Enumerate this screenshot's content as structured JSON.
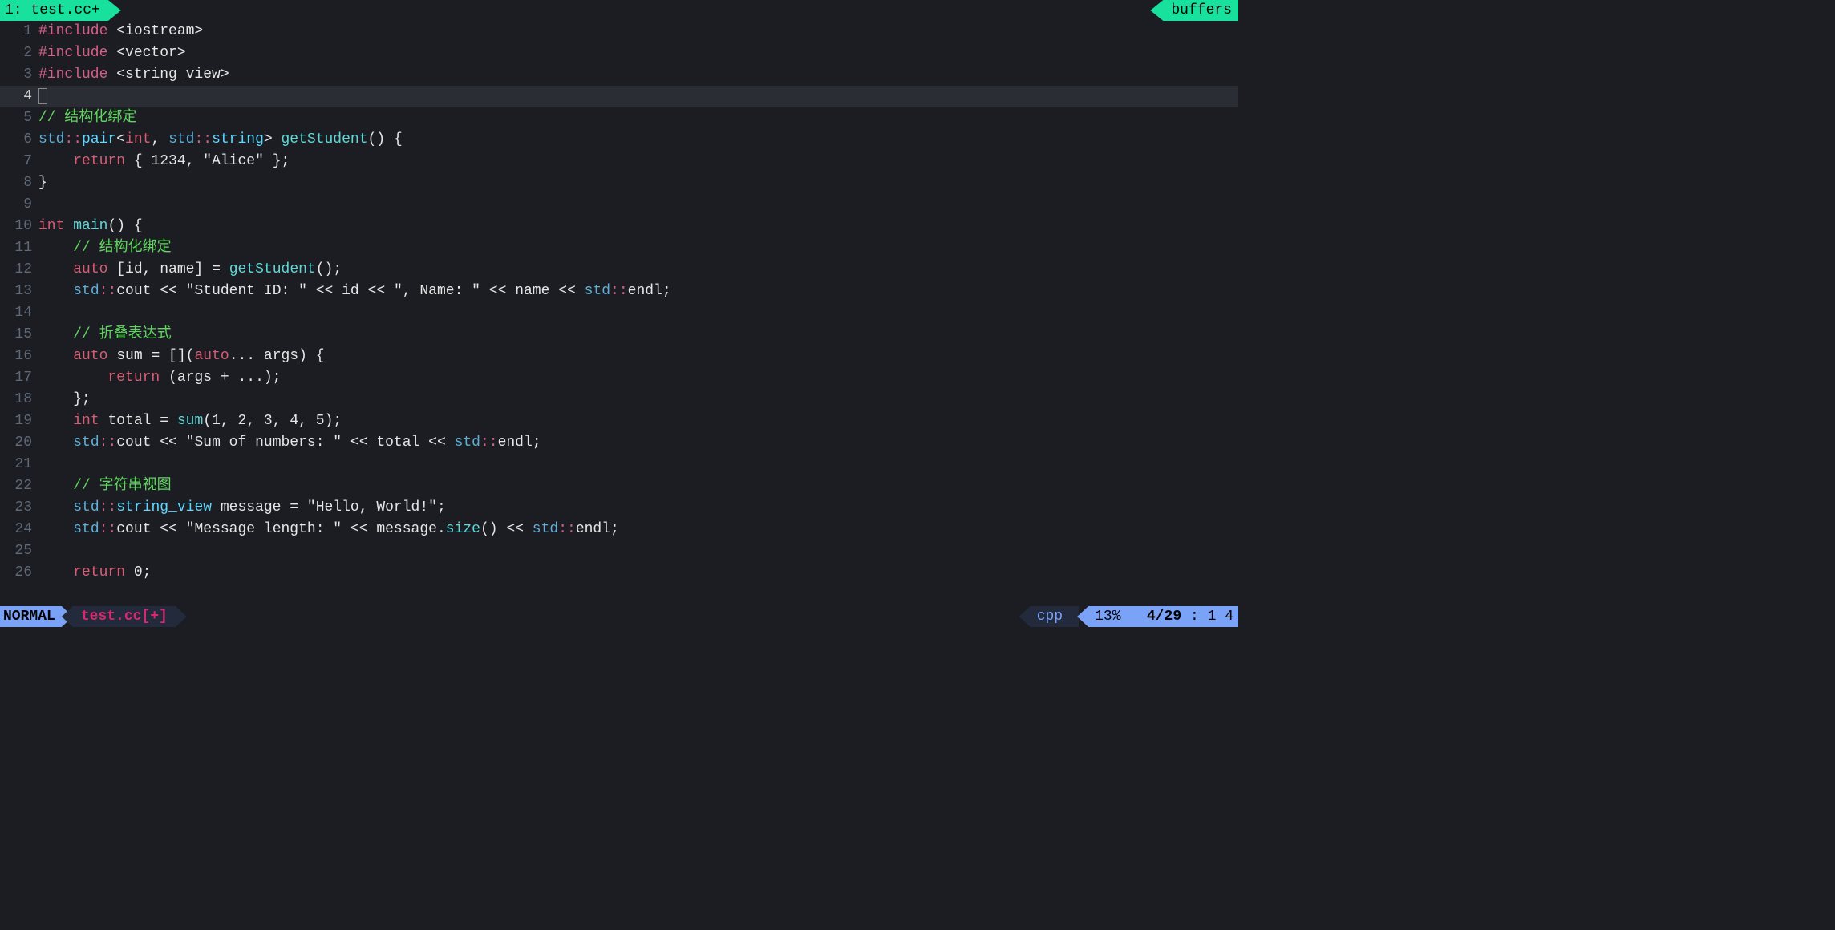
{
  "tabline": {
    "active_tab": "1: test.cc+",
    "right_label": "buffers"
  },
  "cursor_line": 4,
  "lines": [
    {
      "n": 1,
      "tokens": [
        [
          "c-include",
          "#include "
        ],
        [
          "c-header",
          "<iostream>"
        ]
      ]
    },
    {
      "n": 2,
      "tokens": [
        [
          "c-include",
          "#include "
        ],
        [
          "c-header",
          "<vector>"
        ]
      ]
    },
    {
      "n": 3,
      "tokens": [
        [
          "c-include",
          "#include "
        ],
        [
          "c-header",
          "<string_view>"
        ]
      ]
    },
    {
      "n": 4,
      "tokens": [],
      "cursor": true
    },
    {
      "n": 5,
      "tokens": [
        [
          "c-comment",
          "// 结构化绑定"
        ]
      ]
    },
    {
      "n": 6,
      "tokens": [
        [
          "c-ns",
          "std"
        ],
        [
          "c-op",
          "::"
        ],
        [
          "c-type",
          "pair"
        ],
        [
          "c-punc",
          "<"
        ],
        [
          "c-keyword",
          "int"
        ],
        [
          "c-punc",
          ", "
        ],
        [
          "c-ns",
          "std"
        ],
        [
          "c-op",
          "::"
        ],
        [
          "c-type",
          "string"
        ],
        [
          "c-punc",
          "> "
        ],
        [
          "c-func",
          "getStudent"
        ],
        [
          "c-punc",
          "() {"
        ]
      ]
    },
    {
      "n": 7,
      "tokens": [
        [
          "c-punc",
          "    "
        ],
        [
          "c-keyword",
          "return"
        ],
        [
          "c-punc",
          " { "
        ],
        [
          "c-number",
          "1234"
        ],
        [
          "c-punc",
          ", "
        ],
        [
          "c-string",
          "\"Alice\""
        ],
        [
          "c-punc",
          " };"
        ]
      ]
    },
    {
      "n": 8,
      "tokens": [
        [
          "c-punc",
          "}"
        ]
      ]
    },
    {
      "n": 9,
      "tokens": []
    },
    {
      "n": 10,
      "tokens": [
        [
          "c-keyword",
          "int"
        ],
        [
          "c-punc",
          " "
        ],
        [
          "c-func",
          "main"
        ],
        [
          "c-punc",
          "() {"
        ]
      ]
    },
    {
      "n": 11,
      "tokens": [
        [
          "c-punc",
          "    "
        ],
        [
          "c-comment",
          "// 结构化绑定"
        ]
      ]
    },
    {
      "n": 12,
      "tokens": [
        [
          "c-punc",
          "    "
        ],
        [
          "c-auto",
          "auto"
        ],
        [
          "c-punc",
          " ["
        ],
        [
          "c-ident",
          "id"
        ],
        [
          "c-punc",
          ", "
        ],
        [
          "c-ident",
          "name"
        ],
        [
          "c-punc",
          "] = "
        ],
        [
          "c-funccall",
          "getStudent"
        ],
        [
          "c-punc",
          "();"
        ]
      ]
    },
    {
      "n": 13,
      "tokens": [
        [
          "c-punc",
          "    "
        ],
        [
          "c-ns",
          "std"
        ],
        [
          "c-op",
          "::"
        ],
        [
          "c-ident",
          "cout"
        ],
        [
          "c-punc",
          " << "
        ],
        [
          "c-string",
          "\"Student ID: \""
        ],
        [
          "c-punc",
          " << "
        ],
        [
          "c-ident",
          "id"
        ],
        [
          "c-punc",
          " << "
        ],
        [
          "c-string",
          "\", Name: \""
        ],
        [
          "c-punc",
          " << "
        ],
        [
          "c-ident",
          "name"
        ],
        [
          "c-punc",
          " << "
        ],
        [
          "c-ns",
          "std"
        ],
        [
          "c-op",
          "::"
        ],
        [
          "c-ident",
          "endl"
        ],
        [
          "c-punc",
          ";"
        ]
      ]
    },
    {
      "n": 14,
      "tokens": []
    },
    {
      "n": 15,
      "tokens": [
        [
          "c-punc",
          "    "
        ],
        [
          "c-comment",
          "// 折叠表达式"
        ]
      ]
    },
    {
      "n": 16,
      "tokens": [
        [
          "c-punc",
          "    "
        ],
        [
          "c-auto",
          "auto"
        ],
        [
          "c-punc",
          " "
        ],
        [
          "c-ident",
          "sum"
        ],
        [
          "c-punc",
          " = []("
        ],
        [
          "c-auto",
          "auto"
        ],
        [
          "c-punc",
          "... "
        ],
        [
          "c-ident",
          "args"
        ],
        [
          "c-punc",
          ") {"
        ]
      ]
    },
    {
      "n": 17,
      "tokens": [
        [
          "c-punc",
          "        "
        ],
        [
          "c-keyword",
          "return"
        ],
        [
          "c-punc",
          " ("
        ],
        [
          "c-ident",
          "args"
        ],
        [
          "c-punc",
          " + ...);"
        ]
      ]
    },
    {
      "n": 18,
      "tokens": [
        [
          "c-punc",
          "    };"
        ]
      ]
    },
    {
      "n": 19,
      "tokens": [
        [
          "c-punc",
          "    "
        ],
        [
          "c-keyword",
          "int"
        ],
        [
          "c-punc",
          " "
        ],
        [
          "c-ident",
          "total"
        ],
        [
          "c-punc",
          " = "
        ],
        [
          "c-funccall",
          "sum"
        ],
        [
          "c-punc",
          "("
        ],
        [
          "c-number",
          "1"
        ],
        [
          "c-punc",
          ", "
        ],
        [
          "c-number",
          "2"
        ],
        [
          "c-punc",
          ", "
        ],
        [
          "c-number",
          "3"
        ],
        [
          "c-punc",
          ", "
        ],
        [
          "c-number",
          "4"
        ],
        [
          "c-punc",
          ", "
        ],
        [
          "c-number",
          "5"
        ],
        [
          "c-punc",
          ");"
        ]
      ]
    },
    {
      "n": 20,
      "tokens": [
        [
          "c-punc",
          "    "
        ],
        [
          "c-ns",
          "std"
        ],
        [
          "c-op",
          "::"
        ],
        [
          "c-ident",
          "cout"
        ],
        [
          "c-punc",
          " << "
        ],
        [
          "c-string",
          "\"Sum of numbers: \""
        ],
        [
          "c-punc",
          " << "
        ],
        [
          "c-ident",
          "total"
        ],
        [
          "c-punc",
          " << "
        ],
        [
          "c-ns",
          "std"
        ],
        [
          "c-op",
          "::"
        ],
        [
          "c-ident",
          "endl"
        ],
        [
          "c-punc",
          ";"
        ]
      ]
    },
    {
      "n": 21,
      "tokens": []
    },
    {
      "n": 22,
      "tokens": [
        [
          "c-punc",
          "    "
        ],
        [
          "c-comment",
          "// 字符串视图"
        ]
      ]
    },
    {
      "n": 23,
      "tokens": [
        [
          "c-punc",
          "    "
        ],
        [
          "c-ns",
          "std"
        ],
        [
          "c-op",
          "::"
        ],
        [
          "c-type",
          "string_view"
        ],
        [
          "c-punc",
          " "
        ],
        [
          "c-ident",
          "message"
        ],
        [
          "c-punc",
          " = "
        ],
        [
          "c-string",
          "\"Hello, World!\""
        ],
        [
          "c-punc",
          ";"
        ]
      ]
    },
    {
      "n": 24,
      "tokens": [
        [
          "c-punc",
          "    "
        ],
        [
          "c-ns",
          "std"
        ],
        [
          "c-op",
          "::"
        ],
        [
          "c-ident",
          "cout"
        ],
        [
          "c-punc",
          " << "
        ],
        [
          "c-string",
          "\"Message length: \""
        ],
        [
          "c-punc",
          " << "
        ],
        [
          "c-ident",
          "message"
        ],
        [
          "c-punc",
          "."
        ],
        [
          "c-funccall",
          "size"
        ],
        [
          "c-punc",
          "() << "
        ],
        [
          "c-ns",
          "std"
        ],
        [
          "c-op",
          "::"
        ],
        [
          "c-ident",
          "endl"
        ],
        [
          "c-punc",
          ";"
        ]
      ]
    },
    {
      "n": 25,
      "tokens": []
    },
    {
      "n": 26,
      "tokens": [
        [
          "c-punc",
          "    "
        ],
        [
          "c-keyword",
          "return"
        ],
        [
          "c-punc",
          " "
        ],
        [
          "c-number",
          "0"
        ],
        [
          "c-punc",
          ";"
        ]
      ]
    }
  ],
  "status": {
    "mode": "NORMAL",
    "filename": "test.cc[+]",
    "filetype": "cpp",
    "percent": "13%",
    "line": "4",
    "total_lines": "29",
    "col": "1",
    "vcol": "4"
  }
}
